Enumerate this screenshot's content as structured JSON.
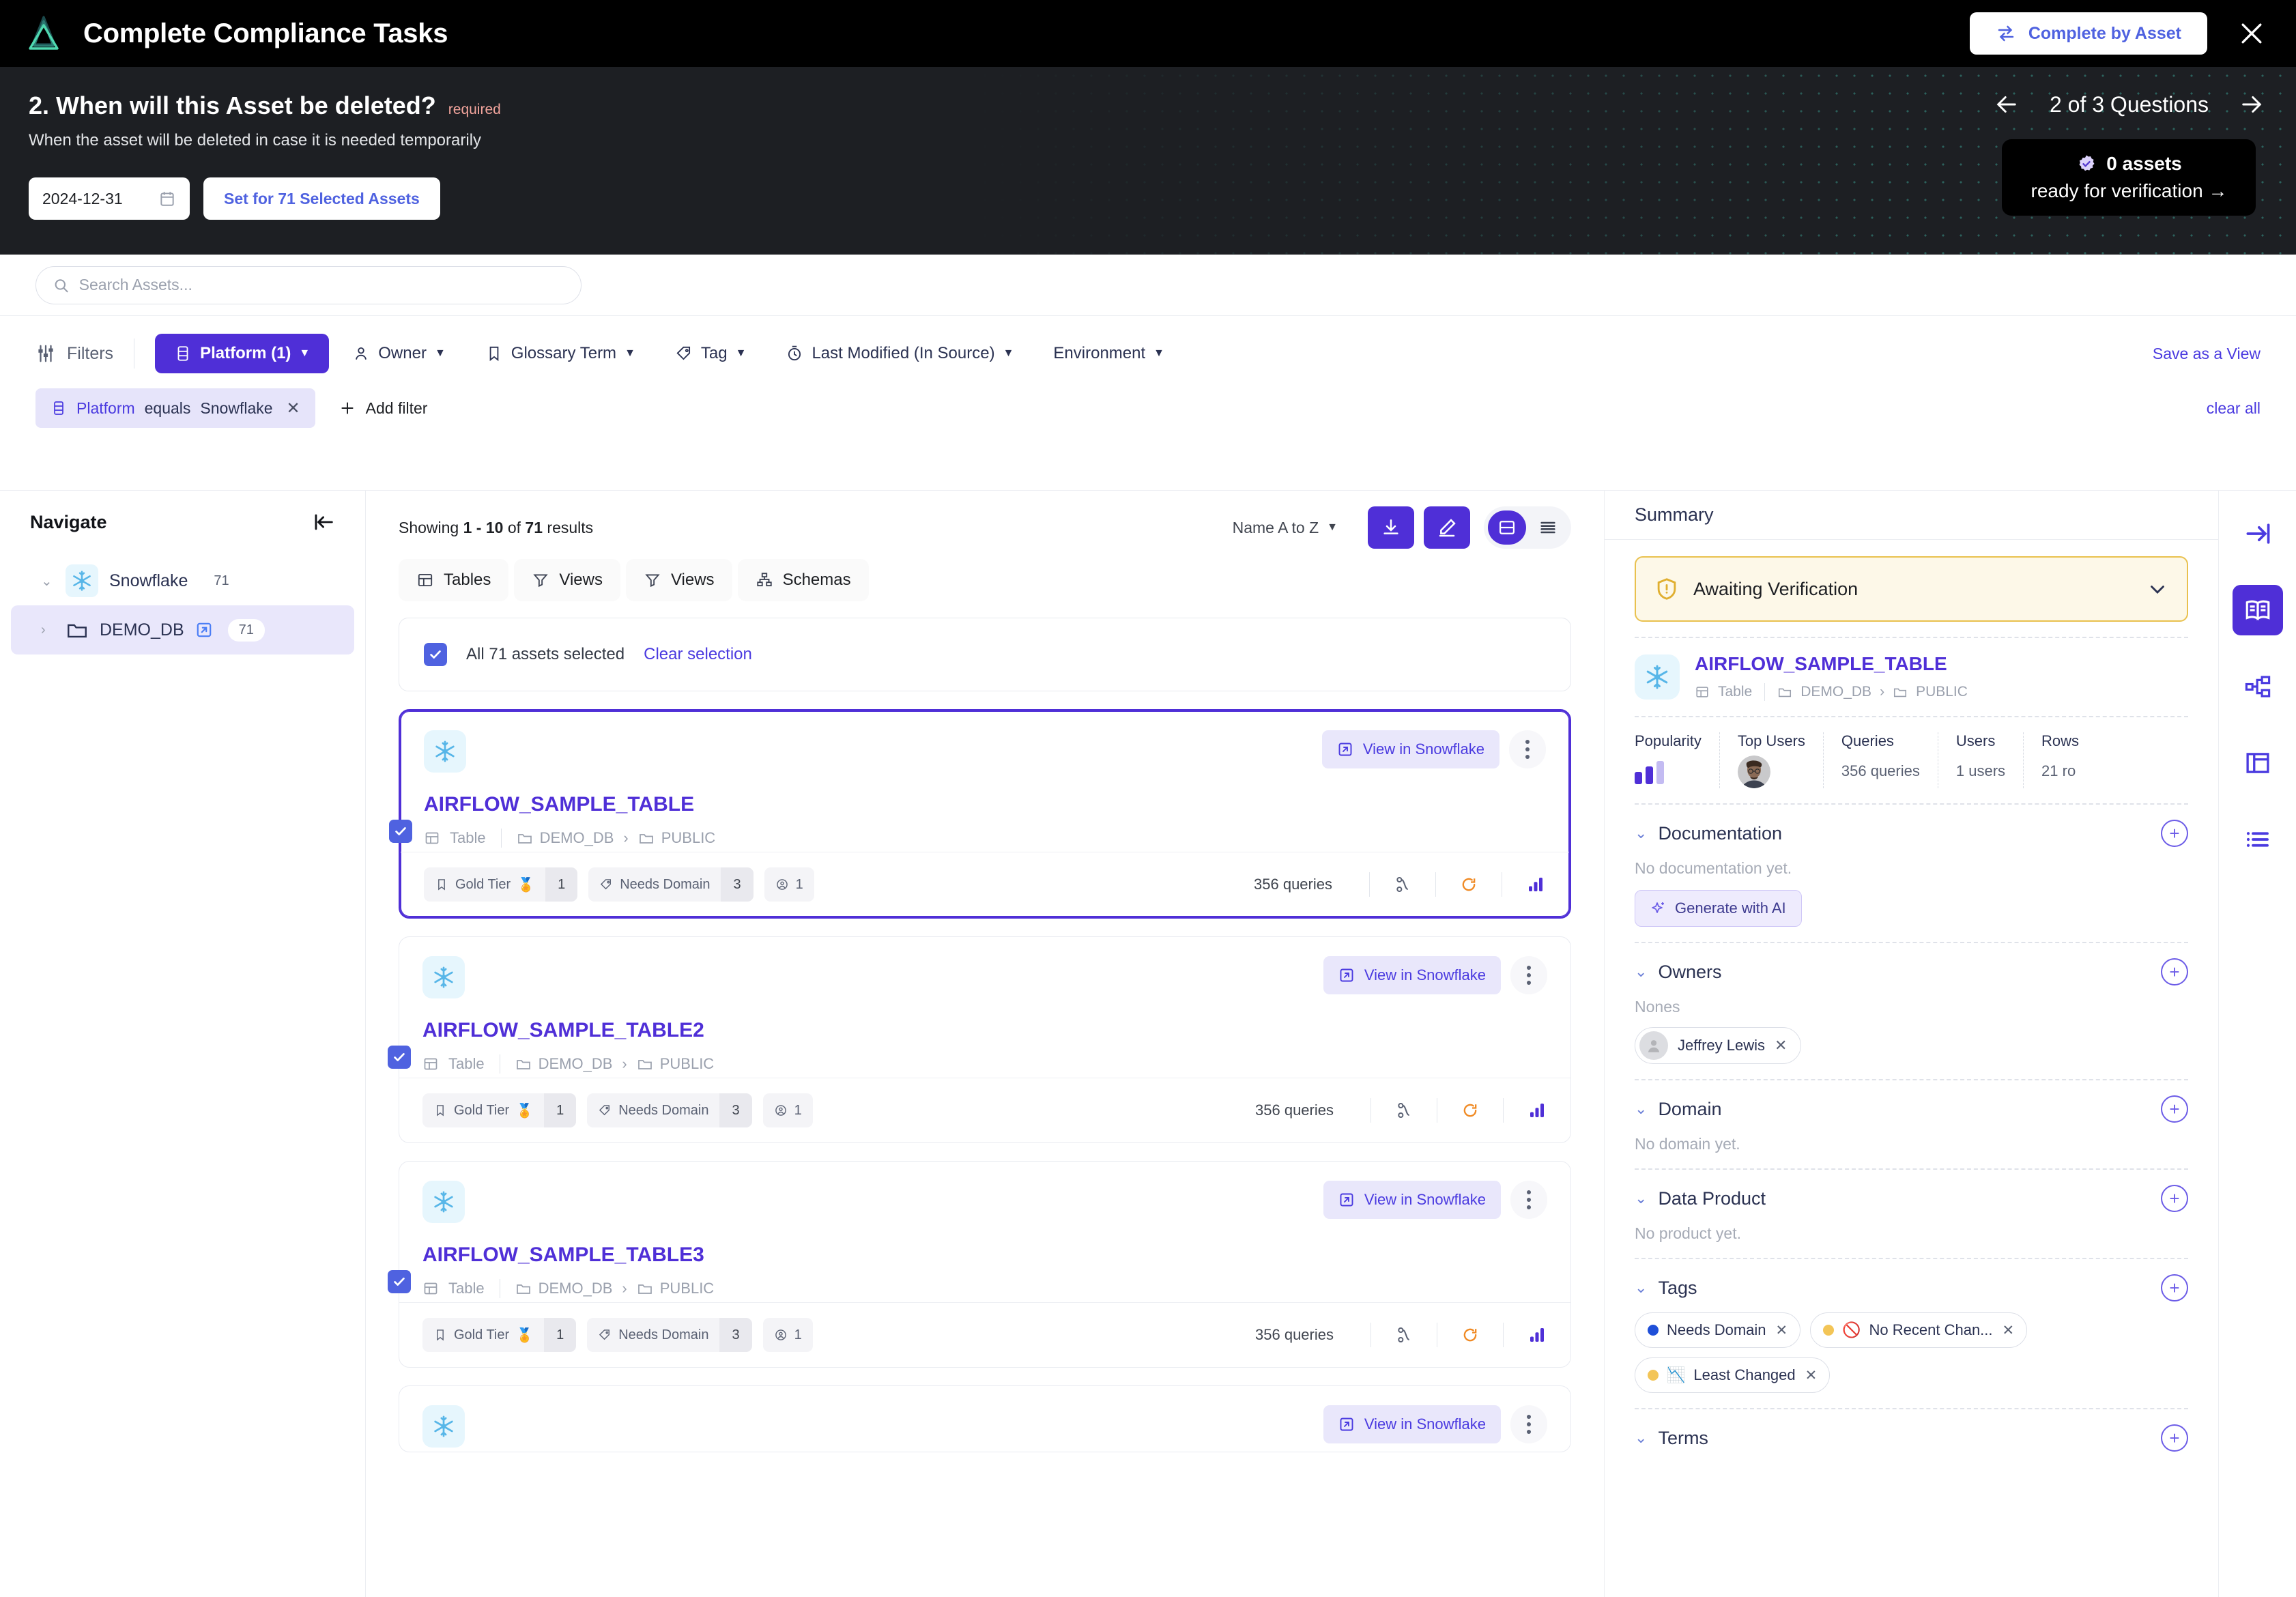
{
  "header": {
    "logo_icon": "nested-triangles-logo",
    "title": "Complete Compliance Tasks",
    "complete_by_asset_label": "Complete by Asset",
    "complete_by_asset_icon": "swap-arrows-icon",
    "close_icon": "close-icon"
  },
  "question": {
    "title": "2. When will this Asset be deleted?",
    "required_label": "required",
    "subtitle": "When the asset will be deleted in case it is needed temporarily",
    "date_value": "2024-12-31",
    "date_icon": "calendar-icon",
    "set_button_label": "Set for 71 Selected Assets",
    "nav_prev_icon": "arrow-left-icon",
    "nav_next_icon": "arrow-right-icon",
    "nav_label": "2 of 3 Questions",
    "ready_icon": "verified-badge-icon",
    "ready_count": "0 assets",
    "ready_label": "ready for verification →"
  },
  "search": {
    "placeholder": "Search Assets...",
    "value": "",
    "icon": "search-icon"
  },
  "filters": {
    "label": "Filters",
    "icon": "sliders-icon",
    "chips": [
      {
        "label": "Platform (1)",
        "icon": "database-icon",
        "active": true
      },
      {
        "label": "Owner",
        "icon": "user-icon",
        "active": false
      },
      {
        "label": "Glossary Term",
        "icon": "bookmark-icon",
        "active": false
      },
      {
        "label": "Tag",
        "icon": "tag-icon",
        "active": false
      },
      {
        "label": "Last Modified (In Source)",
        "icon": "clock-icon",
        "active": false
      },
      {
        "label": "Environment",
        "icon": "none",
        "active": false
      }
    ],
    "save_view_label": "Save as a View",
    "clear_all_label": "clear all",
    "applied": {
      "field": "Platform",
      "operator": "equals",
      "value": "Snowflake",
      "remove_icon": "close-icon"
    },
    "add_filter_label": "Add filter"
  },
  "navigate": {
    "title": "Navigate",
    "collapse_icon": "collapse-left-icon",
    "nodes": [
      {
        "label": "Snowflake",
        "count": "71",
        "icon": "snowflake-icon",
        "expanded": true,
        "selected": false
      },
      {
        "label": "DEMO_DB",
        "count": "71",
        "icon": "folder-icon",
        "expanded": false,
        "selected": true,
        "external_icon": "external-link-icon"
      }
    ]
  },
  "results": {
    "showing_prefix": "Showing ",
    "showing_range": "1 - 10",
    "showing_mid": " of ",
    "showing_total": "71",
    "showing_suffix": " results",
    "sort_label": "Name A to Z",
    "download_icon": "download-icon",
    "edit_icon": "pencil-icon",
    "view_card_icon": "card-view-icon",
    "view_list_icon": "list-view-icon",
    "tabs": [
      {
        "label": "Tables",
        "icon": "table-icon"
      },
      {
        "label": "Views",
        "icon": "filter-icon"
      },
      {
        "label": "Views",
        "icon": "filter-icon"
      },
      {
        "label": "Schemas",
        "icon": "schema-icon"
      }
    ],
    "selection_bar": {
      "label": "All 71 assets selected",
      "clear_label": "Clear selection"
    },
    "cards": [
      {
        "name": "AIRFLOW_SAMPLE_TABLE",
        "type": "Table",
        "db": "DEMO_DB",
        "schema": "PUBLIC",
        "view_label": "View in Snowflake",
        "tier_label": "Gold Tier",
        "tier_count": "1",
        "domain_label": "Needs Domain",
        "domain_count": "3",
        "users_count": "1",
        "queries": "356 queries",
        "selected": true
      },
      {
        "name": "AIRFLOW_SAMPLE_TABLE2",
        "type": "Table",
        "db": "DEMO_DB",
        "schema": "PUBLIC",
        "view_label": "View in Snowflake",
        "tier_label": "Gold Tier",
        "tier_count": "1",
        "domain_label": "Needs Domain",
        "domain_count": "3",
        "users_count": "1",
        "queries": "356 queries",
        "selected": false
      },
      {
        "name": "AIRFLOW_SAMPLE_TABLE3",
        "type": "Table",
        "db": "DEMO_DB",
        "schema": "PUBLIC",
        "view_label": "View in Snowflake",
        "tier_label": "Gold Tier",
        "tier_count": "1",
        "domain_label": "Needs Domain",
        "domain_count": "3",
        "users_count": "1",
        "queries": "356 queries",
        "selected": false
      },
      {
        "name": "",
        "type": "",
        "db": "",
        "schema": "",
        "view_label": "View in Snowflake",
        "tier_label": "",
        "tier_count": "",
        "domain_label": "",
        "domain_count": "",
        "users_count": "",
        "queries": "",
        "selected": false
      }
    ]
  },
  "summary": {
    "title": "Summary",
    "verification_status": "Awaiting Verification",
    "verification_icon": "shield-alert-icon",
    "asset_name": "AIRFLOW_SAMPLE_TABLE",
    "asset_type": "Table",
    "asset_db": "DEMO_DB",
    "asset_schema": "PUBLIC",
    "stats": [
      {
        "label": "Popularity",
        "value": ""
      },
      {
        "label": "Top Users",
        "value": ""
      },
      {
        "label": "Queries",
        "value": "356 queries"
      },
      {
        "label": "Users",
        "value": "1 users"
      },
      {
        "label": "Rows",
        "value": "21 ro"
      }
    ],
    "sections": {
      "documentation": {
        "title": "Documentation",
        "empty": "No documentation yet.",
        "generate_label": "Generate with AI",
        "generate_icon": "sparkle-icon"
      },
      "owners": {
        "title": "Owners",
        "sub": "Nones",
        "person": "Jeffrey Lewis"
      },
      "domain": {
        "title": "Domain",
        "empty": "No domain yet."
      },
      "data_product": {
        "title": "Data Product",
        "empty": "No product yet."
      },
      "tags": {
        "title": "Tags",
        "items": [
          {
            "label": "Needs Domain",
            "dot": "#1f4fd8",
            "emoji": ""
          },
          {
            "label": "No Recent Chan...",
            "dot": "#f3c557",
            "emoji": "🚫"
          },
          {
            "label": "Least Changed",
            "dot": "#f3c557",
            "emoji": "📉"
          }
        ]
      },
      "terms": {
        "title": "Terms"
      }
    }
  },
  "rail": {
    "items": [
      {
        "icon": "expand-right-icon",
        "active": false
      },
      {
        "icon": "overview-book-icon",
        "active": true
      },
      {
        "icon": "lineage-icon",
        "active": false
      },
      {
        "icon": "columns-icon",
        "active": false
      },
      {
        "icon": "properties-list-icon",
        "active": false
      }
    ]
  },
  "colors": {
    "accent": "#4f2fd7",
    "link": "#4a3ae0",
    "warning": "#e9c14e",
    "dark": "#1d1f23"
  }
}
